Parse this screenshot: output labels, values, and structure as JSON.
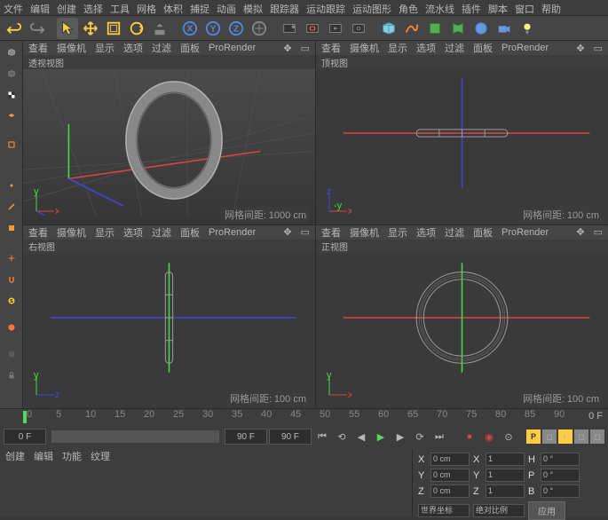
{
  "menu": [
    "文件",
    "编辑",
    "创建",
    "选择",
    "工具",
    "网格",
    "体积",
    "捕捉",
    "动画",
    "模拟",
    "跟踪器",
    "运动跟踪",
    "运动图形",
    "角色",
    "流水线",
    "插件",
    "脚本",
    "窗口",
    "帮助"
  ],
  "viewports": {
    "tl": {
      "menu": [
        "查看",
        "摄像机",
        "显示",
        "选项",
        "过滤",
        "面板",
        "ProRender"
      ],
      "title": "透视视图",
      "status_label": "网格间距:",
      "status_val": "1000 cm"
    },
    "tr": {
      "menu": [
        "查看",
        "摄像机",
        "显示",
        "选项",
        "过滤",
        "面板",
        "ProRender"
      ],
      "title": "顶视图",
      "status_label": "网格间距:",
      "status_val": "100 cm"
    },
    "bl": {
      "menu": [
        "查看",
        "摄像机",
        "显示",
        "选项",
        "过滤",
        "面板",
        "ProRender"
      ],
      "title": "右视图",
      "status_label": "网格间距:",
      "status_val": "100 cm"
    },
    "br": {
      "menu": [
        "查看",
        "摄像机",
        "显示",
        "选项",
        "过滤",
        "面板",
        "ProRender"
      ],
      "title": "正视图",
      "status_label": "网格间距:",
      "status_val": "100 cm"
    }
  },
  "timeline": {
    "marks": [
      "0",
      "5",
      "10",
      "15",
      "20",
      "25",
      "30",
      "35",
      "40",
      "45",
      "50",
      "55",
      "60",
      "65",
      "70",
      "75",
      "80",
      "85",
      "90"
    ],
    "current": "0 F",
    "start": "0 F",
    "range_start": "0 F",
    "range_end": "90 F",
    "end": "90 F"
  },
  "tabs": [
    "创建",
    "编辑",
    "功能",
    "纹理"
  ],
  "coords": {
    "x": {
      "pos": "0 cm",
      "size": "1",
      "rot": "0 °",
      "label_s": "X",
      "label_r": "H"
    },
    "y": {
      "pos": "0 cm",
      "size": "1",
      "rot": "0 °",
      "label_s": "Y",
      "label_r": "P"
    },
    "z": {
      "pos": "0 cm",
      "size": "1",
      "rot": "0 °",
      "label_s": "Z",
      "label_r": "B"
    },
    "mode1": "世界坐标",
    "mode2": "绝对比例",
    "apply": "应用"
  }
}
